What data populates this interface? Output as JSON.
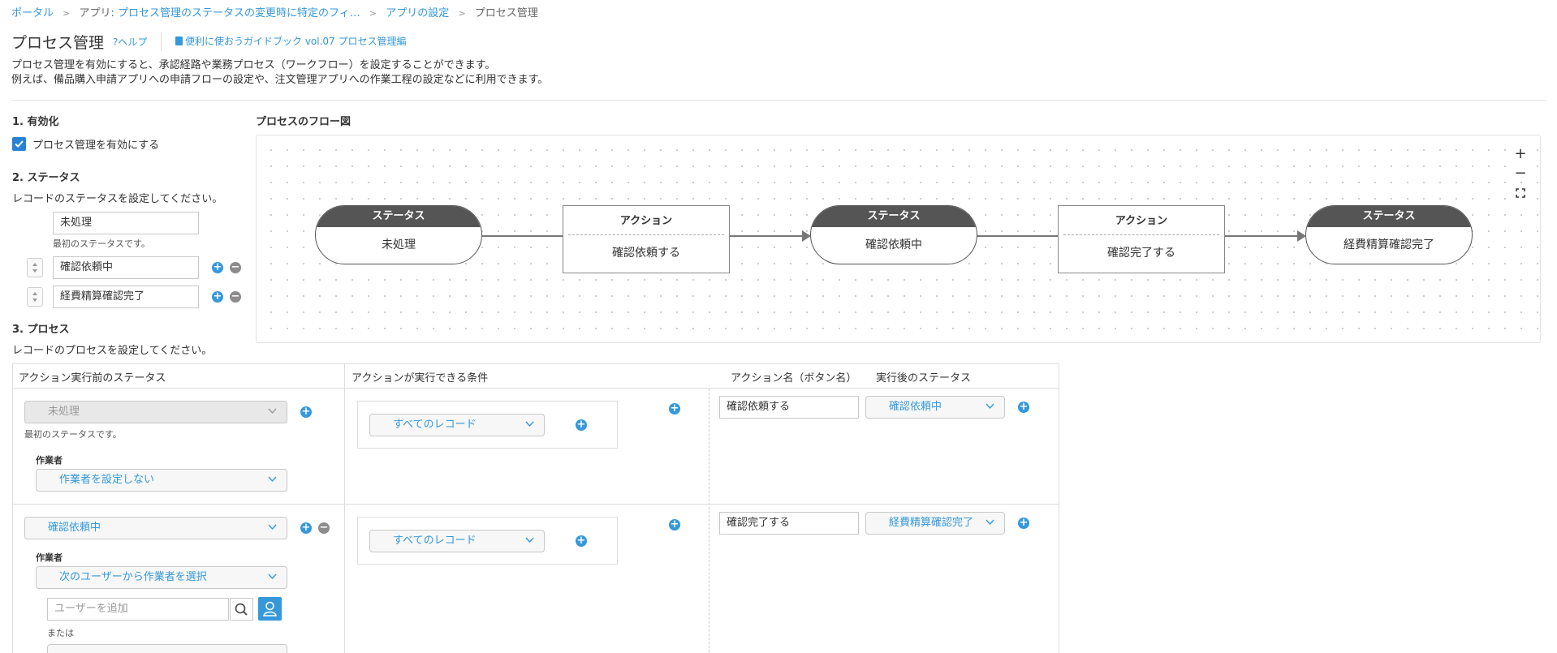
{
  "breadcrumb": {
    "portal": "ポータル",
    "app_prefix": "アプリ: ",
    "app": "プロセス管理のステータスの変更時に特定のフィ…",
    "settings": "アプリの設定",
    "current": "プロセス管理"
  },
  "header": {
    "title": "プロセス管理",
    "help": "?ヘルプ",
    "guide": "便利に使おうガイドブック vol.07 プロセス管理編"
  },
  "description": {
    "line1": "プロセス管理を有効にすると、承認経路や業務プロセス（ワークフロー）を設定することができます。",
    "line2": "例えば、備品購入申請アプリへの申請フローの設定や、注文管理アプリへの作業工程の設定などに利用できます。"
  },
  "enable": {
    "title": "1. 有効化",
    "checkbox_label": "プロセス管理を有効にする",
    "checked": true
  },
  "status": {
    "title": "2. ステータス",
    "subtitle": "レコードのステータスを設定してください。",
    "items": [
      {
        "value": "未処理",
        "note": "最初のステータスです。"
      },
      {
        "value": "確認依頼中"
      },
      {
        "value": "経費精算確認完了"
      }
    ]
  },
  "flow": {
    "title": "プロセスのフロー図",
    "status_header": "ステータス",
    "action_header": "アクション",
    "nodes": {
      "s1": "未処理",
      "a1": "確認依頼する",
      "s2": "確認依頼中",
      "a2": "確認完了する",
      "s3": "経費精算確認完了"
    },
    "zoom_in": "+",
    "zoom_out": "−"
  },
  "process": {
    "title": "3. プロセス",
    "subtitle": "レコードのプロセスを設定してください。",
    "columns": {
      "before": "アクション実行前のステータス",
      "condition": "アクションが実行できる条件",
      "action_name": "アクション名（ボタン名）",
      "after": "実行後のステータス"
    },
    "rows": [
      {
        "status": "未処理",
        "status_note": "最初のステータスです。",
        "assignee_label": "作業者",
        "assignee": "作業者を設定しない",
        "condition": "すべてのレコード",
        "action_name": "確認依頼する",
        "next_status": "確認依頼中"
      },
      {
        "status": "確認依頼中",
        "assignee_label": "作業者",
        "assignee": "次のユーザーから作業者を選択",
        "user_placeholder": "ユーザーを追加",
        "or_label": "または",
        "condition": "すべてのレコード",
        "action_name": "確認完了する",
        "next_status": "経費精算確認完了"
      }
    ]
  },
  "colors": {
    "accent": "#3498db",
    "node_dark": "#555555",
    "checkbox": "#2a82d4"
  }
}
